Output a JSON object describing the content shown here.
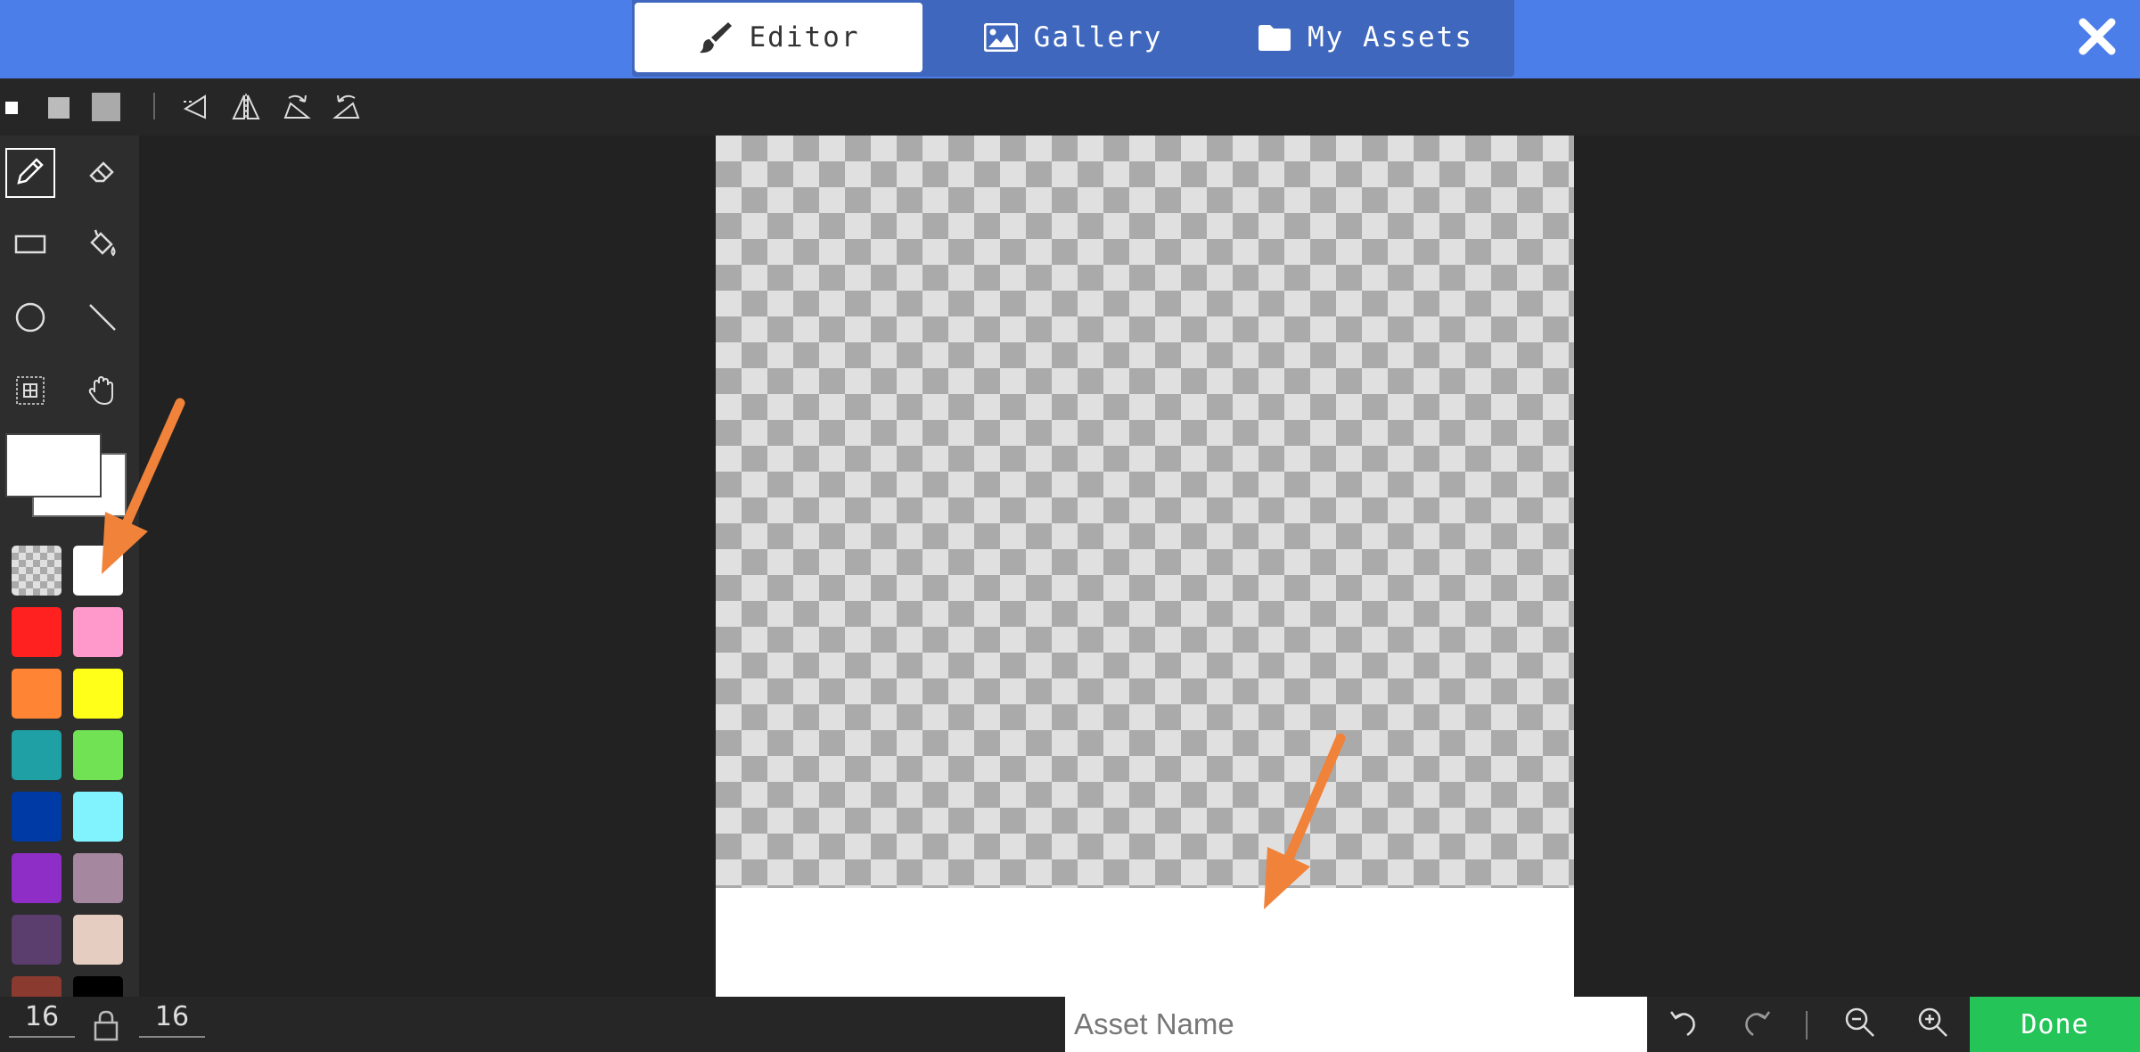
{
  "header": {
    "tabs": [
      {
        "label": "Editor",
        "icon": "paintbrush-icon",
        "active": true
      },
      {
        "label": "Gallery",
        "icon": "image-icon",
        "active": false
      },
      {
        "label": "My Assets",
        "icon": "folder-icon",
        "active": false
      }
    ],
    "close_icon": "close-icon",
    "colors": {
      "bar": "#4c7eea",
      "tabbar": "#3f67bd"
    }
  },
  "toolbar": {
    "brush_sizes": [
      "small",
      "medium",
      "large"
    ],
    "transform_icons": [
      "flip-horizontal-icon",
      "flip-vertical-icon",
      "rotate-clockwise-icon",
      "rotate-counterclockwise-icon"
    ]
  },
  "palette": {
    "tools": [
      "pencil-icon",
      "eraser-icon",
      "rectangle-icon",
      "fill-bucket-icon",
      "circle-icon",
      "line-icon",
      "marquee-icon",
      "pan-hand-icon"
    ],
    "selected_tool": "pencil",
    "primary_color": "#ffffff",
    "secondary_color": "#ffffff",
    "swatches": [
      "transparent",
      "#ffffff",
      "#ff2020",
      "#ff99cc",
      "#ff8534",
      "#ffff1a",
      "#1fa0a4",
      "#72e255",
      "#003aa5",
      "#80f3ff",
      "#8e2ec6",
      "#a5879f",
      "#5b3d6e",
      "#e6cdc1",
      "#8b3a2f",
      "#000000"
    ]
  },
  "canvas": {
    "size": "16x16",
    "transparent": true
  },
  "bottombar": {
    "width_value": "16",
    "height_value": "16",
    "lock_icon": "lock-icon",
    "asset_name_placeholder": "Asset Name",
    "undo_icon": "undo-icon",
    "redo_icon": "redo-icon",
    "zoom_out_icon": "zoom-out-icon",
    "zoom_in_icon": "zoom-in-icon",
    "done_label": "Done",
    "done_color": "#25c458"
  },
  "annotations": {
    "arrow_color": "#f0823a"
  }
}
